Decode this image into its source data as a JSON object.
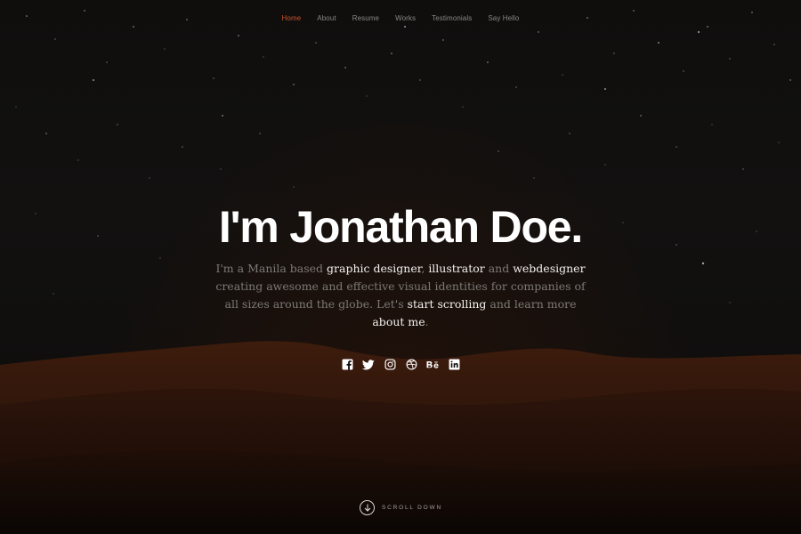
{
  "nav": {
    "items": [
      {
        "label": "Home",
        "active": true
      },
      {
        "label": "About"
      },
      {
        "label": "Resume"
      },
      {
        "label": "Works"
      },
      {
        "label": "Testimonials"
      },
      {
        "label": "Say Hello"
      }
    ]
  },
  "hero": {
    "title": "I'm Jonathan Doe.",
    "intro": {
      "p1": "I'm a Manila based ",
      "l1": "graphic designer",
      "p2": ", ",
      "l2": "illustrator",
      "p3": " and ",
      "l3": "webdesigner",
      "p4": " creating awesome and effective visual identities for companies of all sizes around the globe. Let's ",
      "l4": "start scrolling",
      "p5": " and learn more ",
      "l5": "about me",
      "p6": "."
    }
  },
  "social": {
    "icons": [
      "facebook-icon",
      "twitter-icon",
      "instagram-icon",
      "dribbble-icon",
      "behance-icon",
      "linkedin-icon"
    ]
  },
  "scroll": {
    "label": "SCROLL DOWN",
    "icon": "arrow-down-icon"
  },
  "colors": {
    "accent": "#c9552b",
    "background": "#0b0a09",
    "dune": "#3a1a0c",
    "text_muted": "#7c7976",
    "text_highlight": "#f2f0ee"
  }
}
